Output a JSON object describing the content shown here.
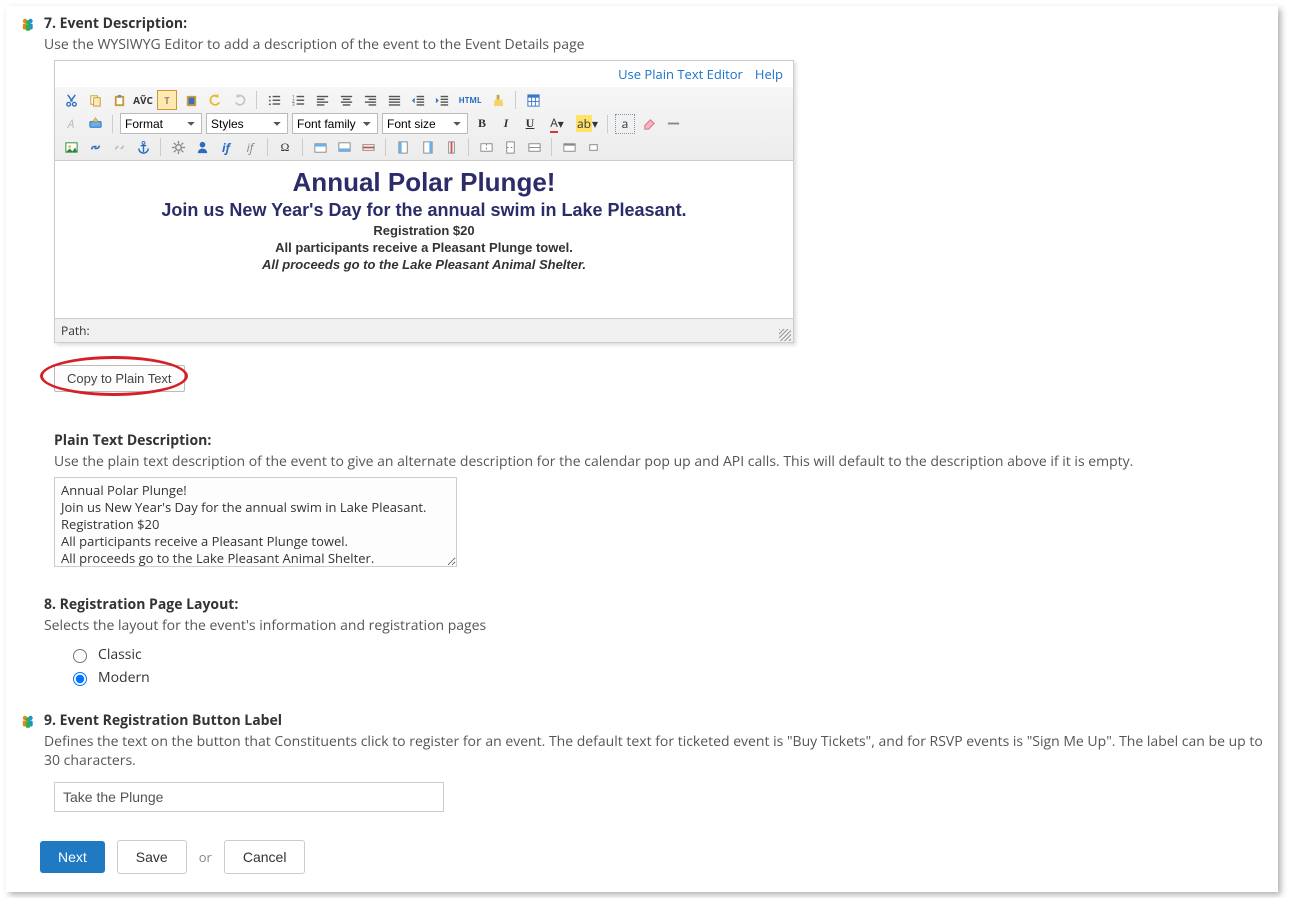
{
  "sections": {
    "seven": {
      "title": "7. Event Description:",
      "subtitle": "Use the WYSIWYG Editor to add a description of the event to the Event Details page"
    },
    "eight": {
      "title": "8. Registration Page Layout:",
      "subtitle": "Selects the layout for the event's information and registration pages"
    },
    "nine": {
      "title": "9. Event Registration Button Label",
      "subtitle": "Defines the text on the button that Constituents click to register for an event. The default text for ticketed event is \"Buy Tickets\", and for RSVP events is \"Sign Me Up\". The label can be up to 30 characters."
    }
  },
  "editor_topbar": {
    "plain_link": "Use Plain Text Editor",
    "help_link": "Help"
  },
  "toolbar": {
    "format": "Format",
    "styles": "Styles",
    "fontfamily": "Font family",
    "fontsize": "Font size",
    "html_label": "HTML",
    "if": "if",
    "if_italic": "if"
  },
  "editor_content": {
    "h1": "Annual Polar Plunge!",
    "h2": "Join us New Year's Day for the annual swim in Lake Pleasant.",
    "l1": "Registration $20",
    "l2": "All participants receive a Pleasant Plunge towel.",
    "l3": "All proceeds go to the Lake Pleasant Animal Shelter."
  },
  "path_label": "Path:",
  "copy_btn": "Copy to Plain Text",
  "plaintext": {
    "label": "Plain Text Description:",
    "subtitle": "Use the plain text description of the event to give an alternate description for the calendar pop up and API calls. This will default to the description above if it is empty.",
    "value": "Annual Polar Plunge!\nJoin us New Year's Day for the annual swim in Lake Pleasant.\nRegistration $20\nAll participants receive a Pleasant Plunge towel.\nAll proceeds go to the Lake Pleasant Animal Shelter."
  },
  "layout_radios": {
    "classic": "Classic",
    "modern": "Modern"
  },
  "button_label_value": "Take the Plunge",
  "buttons": {
    "next": "Next",
    "save": "Save",
    "or": "or",
    "cancel": "Cancel"
  }
}
